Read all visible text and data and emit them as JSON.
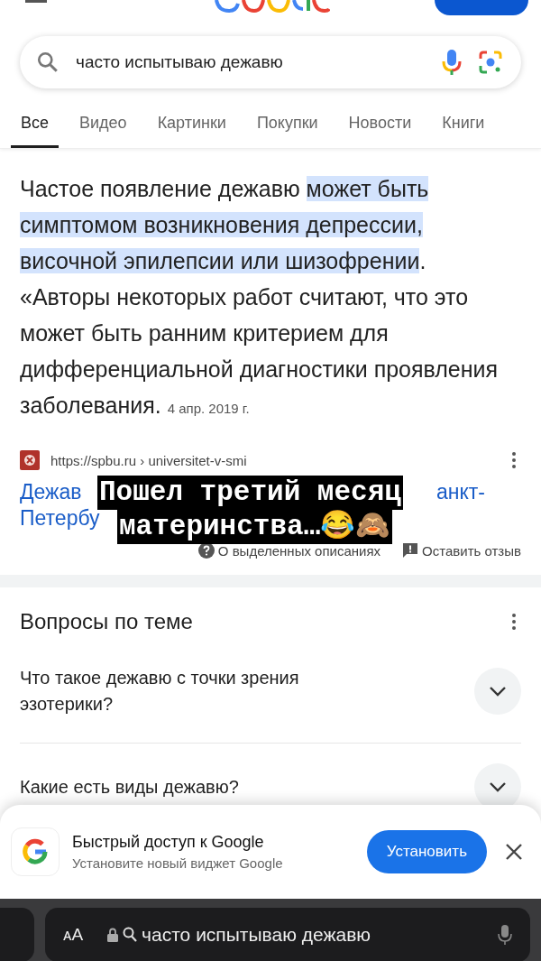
{
  "search": {
    "value": "часто испытываю дежавю"
  },
  "tabs": [
    {
      "label": "Все",
      "selected": true
    },
    {
      "label": "Видео",
      "selected": false
    },
    {
      "label": "Картинки",
      "selected": false
    },
    {
      "label": "Покупки",
      "selected": false
    },
    {
      "label": "Новости",
      "selected": false
    },
    {
      "label": "Книги",
      "selected": false
    }
  ],
  "snippet": {
    "parts": [
      {
        "text": "Частое появление дежавю ",
        "highlighted": false
      },
      {
        "text": "может быть симптомом возникновения депрессии, височной эпилепсии или шизофрении",
        "highlighted": true
      },
      {
        "text": ". «Авторы некоторых работ считают, что это может быть ранним критерием для дифференциальной диагностики проявления заболевания.",
        "highlighted": false
      }
    ],
    "date": "4 апр. 2019 г."
  },
  "source": {
    "url": "https://spbu.ru › universitet-v-smi",
    "title_left": "Дежав",
    "title_right": "анкт-",
    "title_line2": "Петербу"
  },
  "overlay": {
    "line1": "Пошел третий месяц",
    "line2": "материнства…😂🙈"
  },
  "feedback": {
    "about": "О выделенных описаниях",
    "leave": "Оставить отзыв"
  },
  "questions": {
    "title": "Вопросы по теме",
    "items": [
      {
        "text": "Что такое дежавю с точки зрения эзотерики?",
        "expanded": false
      },
      {
        "text": "Какие есть виды дежавю?",
        "expanded": false
      }
    ]
  },
  "banner": {
    "title": "Быстрый доступ к Google",
    "subtitle": "Установите новый виджет Google",
    "button": "Установить"
  },
  "browser": {
    "text_size": "ᴀA",
    "address": "часто испытываю дежавю"
  }
}
